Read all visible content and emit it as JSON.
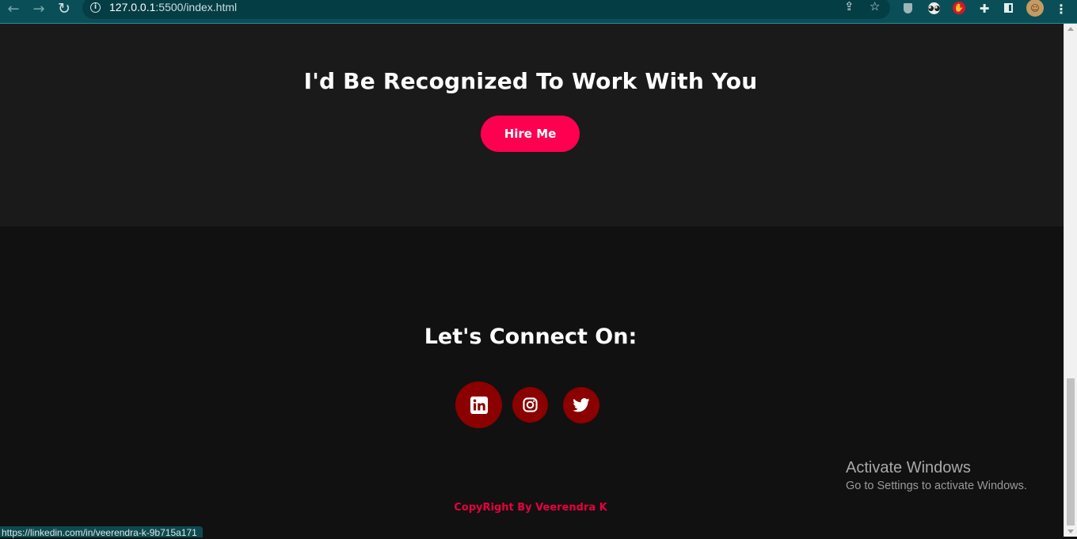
{
  "browser": {
    "url_host": "127.0.0.1",
    "url_path": ":5500/index.html",
    "status_url": "https://linkedin.com/in/veerendra-k-9b715a171"
  },
  "hire": {
    "title": "I'd Be Recognized To Work With You",
    "button_label": "Hire Me"
  },
  "footer": {
    "connect_title": "Let's Connect On:",
    "social": [
      {
        "name": "linkedin-icon"
      },
      {
        "name": "instagram-icon"
      },
      {
        "name": "twitter-icon"
      }
    ],
    "copyright": "CopyRight By Veerendra K"
  },
  "watermark": {
    "line1": "Activate Windows",
    "line2": "Go to Settings to activate Windows."
  },
  "colors": {
    "accent": "#ff0051",
    "social_bg": "#8b0000",
    "copyright": "#e6003d",
    "chrome": "#0a4f57"
  }
}
